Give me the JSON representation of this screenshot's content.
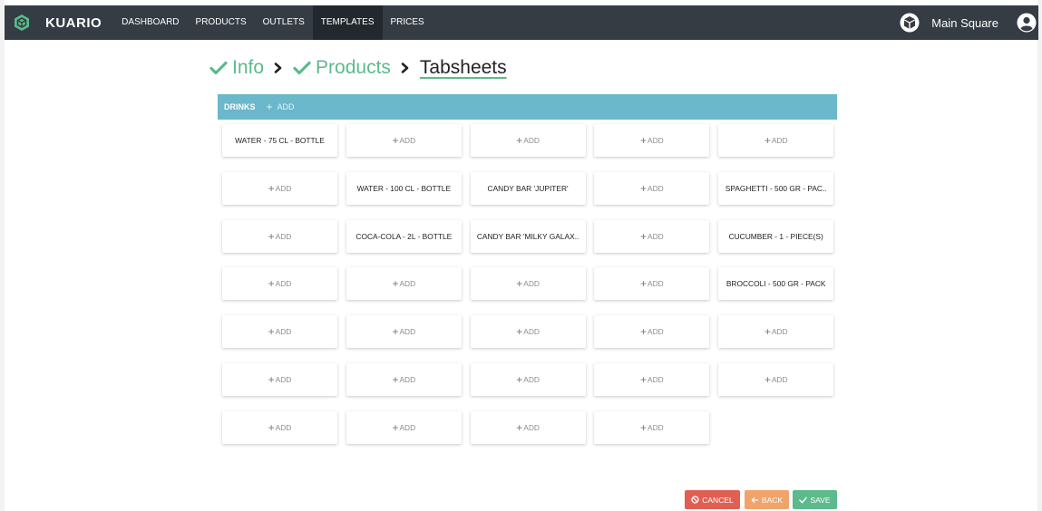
{
  "brand": {
    "name": "KUARIO"
  },
  "nav": {
    "items": [
      {
        "label": "DASHBOARD"
      },
      {
        "label": "PRODUCTS"
      },
      {
        "label": "OUTLETS"
      },
      {
        "label": "TEMPLATES"
      },
      {
        "label": "PRICES"
      }
    ],
    "active": "TEMPLATES",
    "location": "Main Square"
  },
  "breadcrumb": {
    "steps": [
      "Info",
      "Products",
      "Tabsheets"
    ]
  },
  "tabs": {
    "current": "DRINKS",
    "add_label": "ADD"
  },
  "grid": {
    "columns": 5,
    "add_label": "ADD",
    "cells": [
      [
        "WATER - 75 CL - BOTTLE",
        "",
        "",
        "",
        ""
      ],
      [
        "",
        "WATER - 100 CL - BOTTLE",
        "CANDY BAR 'JUPITER'",
        "",
        "SPAGHETTI - 500 GR - PAC.."
      ],
      [
        "",
        "COCA-COLA - 2L - BOTTLE",
        "CANDY BAR 'MILKY GALAX..",
        "",
        "CUCUMBER - 1 - PIECE(S)"
      ],
      [
        "",
        "",
        "",
        "",
        "BROCCOLI - 500 GR - PACK"
      ],
      [
        "",
        "",
        "",
        "",
        ""
      ],
      [
        "",
        "",
        "",
        "",
        ""
      ],
      [
        "",
        "",
        "",
        ""
      ]
    ]
  },
  "buttons": {
    "cancel": "CANCEL",
    "back": "BACK",
    "save": "SAVE"
  },
  "colors": {
    "navbar": "#353c44",
    "accent_green": "#5cba8c",
    "tabs_bar": "#6bb7cb",
    "cancel": "#e05f52",
    "back": "#f0a46b"
  },
  "icons": {
    "brand": "kuario-logo-icon",
    "location": "store-box-icon",
    "user": "user-account-icon",
    "step_done": "check-icon",
    "separator": "chevron-right-icon",
    "cancel": "ban-icon",
    "back": "arrow-left-icon",
    "save": "check-icon"
  }
}
